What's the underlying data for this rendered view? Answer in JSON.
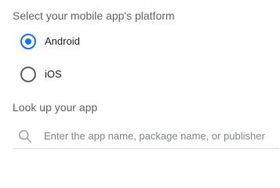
{
  "platform_section": {
    "heading": "Select your mobile app's platform",
    "options": [
      {
        "label": "Android",
        "selected": true
      },
      {
        "label": "iOS",
        "selected": false
      }
    ]
  },
  "lookup_section": {
    "heading": "Look up your app",
    "search": {
      "value": "",
      "placeholder": "Enter the app name, package name, or publisher"
    }
  },
  "colors": {
    "accent": "#1a73e8",
    "secondary_text": "#5f6368",
    "divider": "#dadce0"
  },
  "icons": {
    "search": "search-icon"
  }
}
